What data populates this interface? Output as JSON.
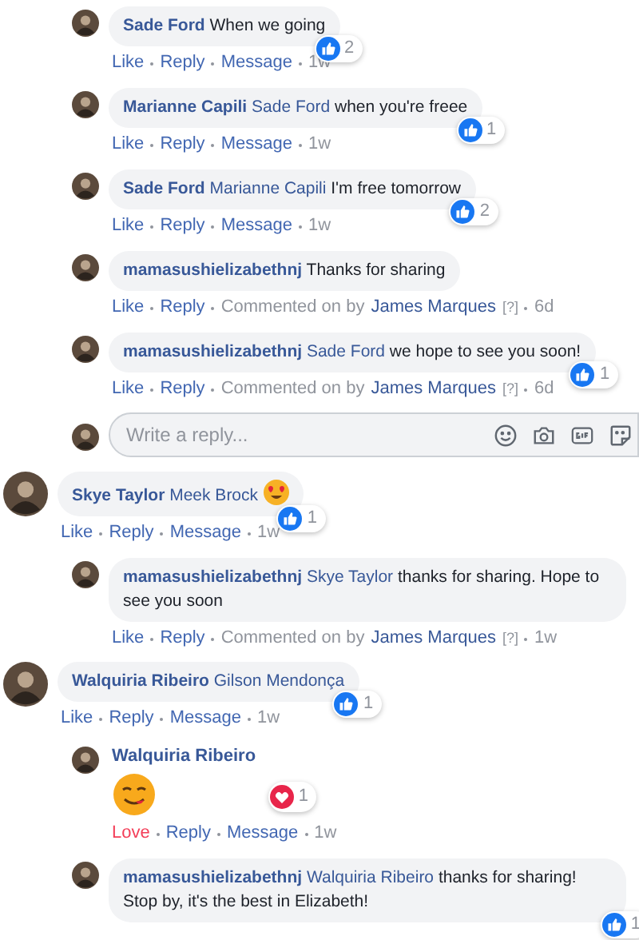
{
  "earlier_replies": [
    {
      "kind": "text",
      "author": "Sade Ford",
      "text": "When we going",
      "reaction": {
        "kind": "like",
        "count": "2"
      },
      "actions": [
        {
          "kind": "like",
          "text": "Like"
        },
        {
          "kind": "link",
          "text": "Reply"
        },
        {
          "kind": "link",
          "text": "Message"
        },
        {
          "kind": "time",
          "text": "1w"
        }
      ]
    },
    {
      "kind": "text",
      "author": "Marianne Capili",
      "mention": "Sade Ford",
      "text": "when you're freee",
      "reaction": {
        "kind": "like",
        "count": "1"
      },
      "actions": [
        {
          "kind": "like",
          "text": "Like"
        },
        {
          "kind": "link",
          "text": "Reply"
        },
        {
          "kind": "link",
          "text": "Message"
        },
        {
          "kind": "time",
          "text": "1w"
        }
      ]
    },
    {
      "kind": "text",
      "author": "Sade Ford",
      "mention": "Marianne Capili",
      "text": "I'm free tomorrow",
      "reaction": {
        "kind": "like",
        "count": "2"
      },
      "actions": [
        {
          "kind": "like",
          "text": "Like"
        },
        {
          "kind": "link",
          "text": "Reply"
        },
        {
          "kind": "link",
          "text": "Message"
        },
        {
          "kind": "time",
          "text": "1w"
        }
      ]
    },
    {
      "kind": "text",
      "author": "mamasushielizabethnj",
      "text": "Thanks for sharing",
      "actions": [
        {
          "kind": "like",
          "text": "Like"
        },
        {
          "kind": "link",
          "text": "Reply"
        },
        {
          "kind": "note",
          "text": "Commented on by"
        },
        {
          "kind": "author",
          "text": "James Marques"
        },
        {
          "kind": "hint",
          "text": "[?]"
        },
        {
          "kind": "time",
          "text": "6d"
        }
      ]
    },
    {
      "kind": "text",
      "author": "mamasushielizabethnj",
      "mention": "Sade Ford",
      "text": "we hope to see you soon!",
      "reaction": {
        "kind": "like",
        "count": "1"
      },
      "actions": [
        {
          "kind": "like",
          "text": "Like"
        },
        {
          "kind": "link",
          "text": "Reply"
        },
        {
          "kind": "note",
          "text": "Commented on by"
        },
        {
          "kind": "author",
          "text": "James Marques"
        },
        {
          "kind": "hint",
          "text": "[?]"
        },
        {
          "kind": "time",
          "text": "6d"
        }
      ]
    }
  ],
  "reply_box": {
    "placeholder": "Write a reply..."
  },
  "comments": [
    {
      "kind": "text",
      "author": "Skye Taylor",
      "mention": "Meek Brock",
      "has_emoji": true,
      "reaction": {
        "kind": "like",
        "count": "1"
      },
      "actions": [
        {
          "kind": "like",
          "text": "Like"
        },
        {
          "kind": "link",
          "text": "Reply"
        },
        {
          "kind": "link",
          "text": "Message"
        },
        {
          "kind": "time",
          "text": "1w"
        }
      ],
      "children": [
        {
          "kind": "text",
          "author": "mamasushielizabethnj",
          "mention": "Skye Taylor",
          "text": "thanks for sharing. Hope to see you soon",
          "actions": [
            {
              "kind": "like",
              "text": "Like"
            },
            {
              "kind": "link",
              "text": "Reply"
            },
            {
              "kind": "note",
              "text": "Commented on by"
            },
            {
              "kind": "author",
              "text": "James Marques"
            },
            {
              "kind": "hint",
              "text": "[?]"
            },
            {
              "kind": "time",
              "text": "1w"
            }
          ]
        }
      ]
    },
    {
      "kind": "text",
      "author": "Walquiria Ribeiro",
      "mention": "Gilson Mendonça",
      "reaction": {
        "kind": "like",
        "count": "1"
      },
      "actions": [
        {
          "kind": "like",
          "text": "Like"
        },
        {
          "kind": "link",
          "text": "Reply"
        },
        {
          "kind": "link",
          "text": "Message"
        },
        {
          "kind": "time",
          "text": "1w"
        }
      ],
      "children": [
        {
          "kind": "sticker",
          "author": "Walquiria Ribeiro",
          "reaction": {
            "kind": "love",
            "count": "1"
          },
          "actions": [
            {
              "kind": "love",
              "text": "Love"
            },
            {
              "kind": "link",
              "text": "Reply"
            },
            {
              "kind": "link",
              "text": "Message"
            },
            {
              "kind": "time",
              "text": "1w"
            }
          ]
        },
        {
          "kind": "text",
          "author": "mamasushielizabethnj",
          "mention": "Walquiria Ribeiro",
          "text": "thanks for sharing! Stop by, it's the best in Elizabeth!",
          "reaction": {
            "kind": "like",
            "count": "1"
          }
        }
      ]
    }
  ]
}
